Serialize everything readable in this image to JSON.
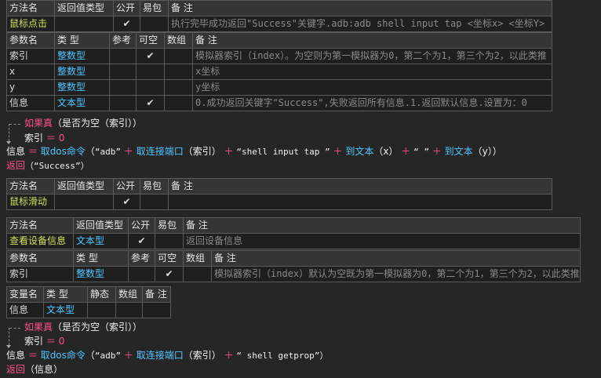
{
  "headers": {
    "method": [
      "方法名",
      "返回值类型",
      "公开",
      "易包",
      "备 注"
    ],
    "params": [
      "参数名",
      "类 型",
      "参考",
      "可空",
      "数组",
      "备 注"
    ],
    "vars": [
      "变量名",
      "类 型",
      "静态",
      "数组",
      "备 注"
    ]
  },
  "check": "✔",
  "block1": {
    "name": "鼠标点击",
    "ret": "",
    "public": true,
    "note": "执行完毕成功返回\"Success\"关键字.adb:adb shell input tap <坐标x> <坐标Y>",
    "params": [
      {
        "name": "索引",
        "type": "整数型",
        "ref": false,
        "nullable": true,
        "array": false,
        "note": "模拟器索引（index）。为空则为第一模拟器为0，第二个为1，第三个为2，以此类推"
      },
      {
        "name": "x",
        "type": "整数型",
        "ref": false,
        "nullable": false,
        "array": false,
        "note": "x坐标"
      },
      {
        "name": "y",
        "type": "整数型",
        "ref": false,
        "nullable": false,
        "array": false,
        "note": "y坐标"
      },
      {
        "name": "信息",
        "type": "文本型",
        "ref": false,
        "nullable": true,
        "array": false,
        "note": "0.成功返回关键字\"Success\",失败返回所有信息.1.返回默认信息.设置为：0"
      }
    ]
  },
  "code1": {
    "if_kw": "如果真",
    "if_cond": "（是否为空（索引））",
    "assign_var": "索引",
    "assign_op": "＝",
    "assign_val": "0",
    "l3_var": "信息",
    "l3_eq": "＝",
    "l3_fn1": "取dos命令",
    "l3_p1": "（",
    "l3_s1": "“adb”",
    "l3_plus1": "＋",
    "l3_fn2": "取连接端口",
    "l3_p2": "（索引）",
    "l3_plus2": "＋",
    "l3_s2": "“shell input tap ”",
    "l3_plus3": "＋",
    "l3_fn3": "到文本",
    "l3_p3": "（x）",
    "l3_plus4": "＋",
    "l3_s3": "“ ”",
    "l3_plus5": "＋",
    "l3_fn4": "到文本",
    "l3_p4": "（y））",
    "ret_kw": "返回",
    "ret_val": "（“Success”）"
  },
  "block2": {
    "name": "鼠标滑动",
    "ret": "",
    "public": true,
    "note": ""
  },
  "block3": {
    "name": "查看设备信息",
    "ret": "文本型",
    "public": true,
    "note": "返回设备信息",
    "params": [
      {
        "name": "索引",
        "type": "整数型",
        "ref": false,
        "nullable": true,
        "array": false,
        "note": "模拟器索引（index）默认为空既为第一模拟器为0，第二个为1，第三个为2，以此类推"
      }
    ],
    "vars": [
      {
        "name": "信息",
        "type": "文本型",
        "static": false,
        "array": false,
        "note": ""
      }
    ]
  },
  "code2": {
    "if_kw": "如果真",
    "if_cond": "（是否为空（索引））",
    "assign_var": "索引",
    "assign_op": "＝",
    "assign_val": "0",
    "l3_var": "信息",
    "l3_eq": "＝",
    "l3_fn1": "取dos命令",
    "l3_p1": "（",
    "l3_s1": "“adb”",
    "l3_plus1": "＋",
    "l3_fn2": "取连接端口",
    "l3_p2": "（索引）",
    "l3_plus2": "＋",
    "l3_s2": "“ shell getprop”）",
    "ret_kw": "返回",
    "ret_val": "（信息）"
  }
}
